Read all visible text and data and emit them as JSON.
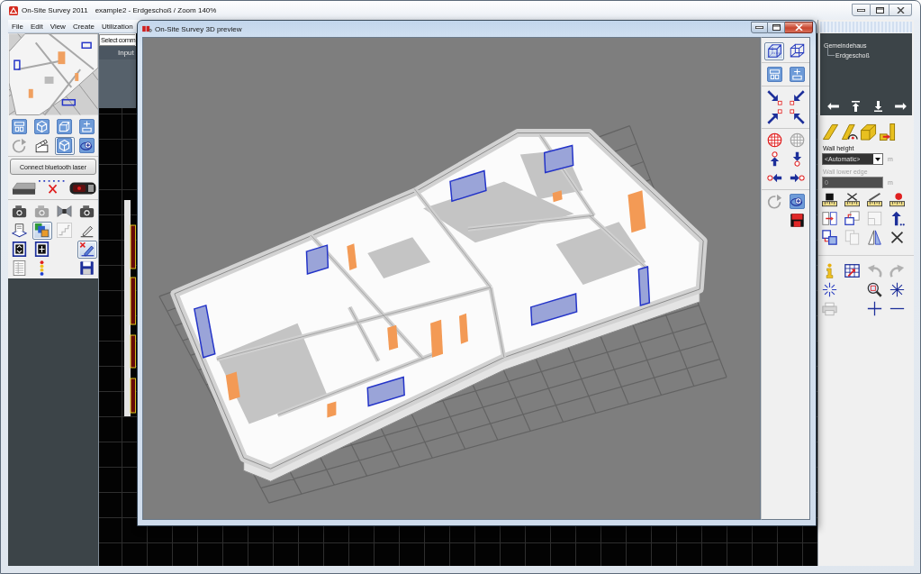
{
  "window": {
    "app_title": "On-Site Survey 2011",
    "document_title": "example2 - Erdgeschoß / Zoom 140%"
  },
  "menu": [
    "File",
    "Edit",
    "View",
    "Create",
    "Utilization"
  ],
  "left_panel": {
    "view_tools": [
      {
        "selected": false,
        "disabled": false
      },
      {
        "selected": false,
        "disabled": false
      },
      {
        "selected": false,
        "disabled": false
      },
      {
        "selected": false,
        "disabled": false
      },
      {
        "selected": false,
        "disabled": true
      },
      {
        "selected": false,
        "disabled": false
      },
      {
        "selected": true,
        "disabled": false
      },
      {
        "selected": false,
        "disabled": false
      }
    ],
    "connect_button": "Connect bluetooth laser",
    "tools": [
      {
        "selected": false,
        "disabled": false
      },
      {
        "selected": false,
        "disabled": true
      },
      {
        "selected": false,
        "disabled": false
      },
      {
        "selected": false,
        "disabled": false
      },
      {
        "selected": false,
        "disabled": false
      },
      {
        "selected": true,
        "disabled": false
      },
      {
        "selected": false,
        "disabled": true
      },
      {
        "selected": false,
        "disabled": false
      },
      {
        "selected": false,
        "disabled": false
      },
      {
        "selected": false,
        "disabled": false
      },
      {
        "selected": true,
        "disabled": false
      },
      {
        "selected": false,
        "disabled": false
      },
      {
        "selected": false,
        "disabled": false
      },
      {
        "selected": false,
        "disabled": false
      }
    ]
  },
  "command_field": {
    "value": "Select comm"
  },
  "input_header": "Input",
  "preview_window": {
    "title": "On-Site Survey 3D preview",
    "tools": [
      {
        "selected": true,
        "disabled": false
      },
      {
        "selected": false,
        "disabled": false
      },
      {
        "selected": false,
        "disabled": false
      },
      {
        "selected": false,
        "disabled": false
      },
      {
        "selected": false,
        "disabled": false
      },
      {
        "selected": false,
        "disabled": false
      },
      {
        "selected": false,
        "disabled": false
      },
      {
        "selected": false,
        "disabled": false
      },
      {
        "selected": false,
        "disabled": false
      },
      {
        "selected": false,
        "disabled": true
      },
      {
        "selected": false,
        "disabled": false
      },
      {
        "selected": false,
        "disabled": false
      },
      {
        "selected": false,
        "disabled": false
      },
      {
        "selected": false,
        "disabled": false
      },
      {
        "selected": false,
        "disabled": true
      },
      {
        "selected": false,
        "disabled": false
      },
      {
        "selected": false,
        "disabled": false
      }
    ]
  },
  "right_panel": {
    "tree": [
      {
        "label": "Gemeindehaus",
        "children": [
          {
            "label": "Erdgeschoß"
          }
        ]
      }
    ],
    "wall_height": {
      "label": "Wall height",
      "value": "<Automatic>",
      "unit": "m",
      "disabled": false
    },
    "wall_lower_edge": {
      "label": "Wall lower edge",
      "value": "0",
      "unit": "m",
      "disabled": true
    },
    "tools": [
      {
        "selected": false,
        "disabled": false
      },
      {
        "selected": false,
        "disabled": false
      },
      {
        "selected": false,
        "disabled": false
      },
      {
        "selected": false,
        "disabled": false
      },
      {
        "selected": false,
        "disabled": false
      },
      {
        "selected": false,
        "disabled": false
      },
      {
        "selected": false,
        "disabled": true
      },
      {
        "selected": false,
        "disabled": false
      },
      {
        "selected": false,
        "disabled": false
      },
      {
        "selected": false,
        "disabled": true
      },
      {
        "selected": false,
        "disabled": false
      },
      {
        "selected": false,
        "disabled": false
      },
      {
        "selected": false,
        "disabled": false
      },
      {
        "selected": false,
        "disabled": false
      },
      {
        "selected": false,
        "disabled": true
      },
      {
        "selected": false,
        "disabled": true
      },
      {
        "selected": false,
        "disabled": false
      },
      {
        "selected": false,
        "disabled": false
      },
      {
        "selected": false,
        "disabled": false
      },
      {
        "selected": false,
        "disabled": true
      },
      {
        "selected": false,
        "disabled": false
      },
      {
        "selected": false,
        "disabled": false
      }
    ]
  }
}
